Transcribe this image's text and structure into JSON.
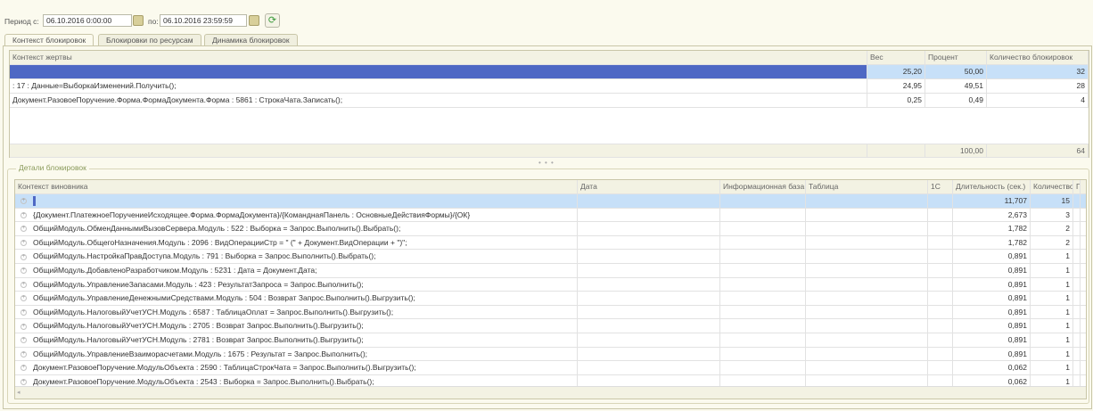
{
  "period": {
    "from_label": "Период с:",
    "from_value": "06.10.2016 0:00:00",
    "to_label": "по:",
    "to_value": "06.10.2016 23:59:59"
  },
  "tabs": [
    {
      "label": "Контекст блокировок",
      "active": true
    },
    {
      "label": "Блокировки по ресурсам"
    },
    {
      "label": "Динамика блокировок"
    }
  ],
  "victims": {
    "columns": [
      "Контекст жертвы",
      "Вес",
      "Процент",
      "Количество блокировок"
    ],
    "rows": [
      {
        "context": "",
        "weight": "25,20",
        "percent": "50,00",
        "count": "32",
        "selected": true
      },
      {
        "context": ": 17 : Данные=ВыборкаИзменений.Получить();",
        "weight": "24,95",
        "percent": "49,51",
        "count": "28"
      },
      {
        "context": "Документ.РазовоеПоручение.Форма.ФормаДокумента.Форма : 5861 : СтрокаЧата.Записать();",
        "weight": "0,25",
        "percent": "0,49",
        "count": "4"
      }
    ],
    "totals": {
      "percent": "100,00",
      "count": "64"
    }
  },
  "details": {
    "group_title": "Детали блокировок",
    "columns": [
      "Контекст виновника",
      "Дата",
      "Информационная база",
      "Таблица",
      "1С",
      "Длительность (сек.)",
      "Количество",
      "П"
    ],
    "rows": [
      {
        "context": "",
        "duration": "11,707",
        "count": "15",
        "selected": true
      },
      {
        "context": "{Документ.ПлатежноеПоручениеИсходящее.Форма.ФормаДокумента}/{КоманднаяПанель : ОсновныеДействияФормы}/{ОК}",
        "duration": "2,673",
        "count": "3"
      },
      {
        "context": "ОбщийМодуль.ОбменДаннымиВызовСервера.Модуль : 522 : Выборка = Запрос.Выполнить().Выбрать();",
        "duration": "1,782",
        "count": "2"
      },
      {
        "context": "ОбщийМодуль.ОбщегоНазначения.Модуль : 2096 : ВидОперацииСтр = \" (\" + Документ.ВидОперации + \")\";",
        "duration": "1,782",
        "count": "2"
      },
      {
        "context": "ОбщийМодуль.НастройкаПравДоступа.Модуль : 791 : Выборка = Запрос.Выполнить().Выбрать();",
        "duration": "0,891",
        "count": "1"
      },
      {
        "context": "ОбщийМодуль.ДобавленоРазработчиком.Модуль : 5231 : Дата = Документ.Дата;",
        "duration": "0,891",
        "count": "1"
      },
      {
        "context": "ОбщийМодуль.УправлениеЗапасами.Модуль : 423 : РезультатЗапроса = Запрос.Выполнить();",
        "duration": "0,891",
        "count": "1"
      },
      {
        "context": "ОбщийМодуль.УправлениеДенежнымиСредствами.Модуль : 504 : Возврат Запрос.Выполнить().Выгрузить();",
        "duration": "0,891",
        "count": "1"
      },
      {
        "context": "ОбщийМодуль.НалоговыйУчетУСН.Модуль : 6587 : ТаблицаОплат = Запрос.Выполнить().Выгрузить();",
        "duration": "0,891",
        "count": "1"
      },
      {
        "context": "ОбщийМодуль.НалоговыйУчетУСН.Модуль : 2705 : Возврат Запрос.Выполнить().Выгрузить();",
        "duration": "0,891",
        "count": "1"
      },
      {
        "context": "ОбщийМодуль.НалоговыйУчетУСН.Модуль : 2781 : Возврат Запрос.Выполнить().Выгрузить();",
        "duration": "0,891",
        "count": "1"
      },
      {
        "context": "ОбщийМодуль.УправлениеВзаиморасчетами.Модуль : 1675 : Результат = Запрос.Выполнить();",
        "duration": "0,891",
        "count": "1"
      },
      {
        "context": "Документ.РазовоеПоручение.МодульОбъекта : 2590 : ТаблицаСтрокЧата = Запрос.Выполнить().Выгрузить();",
        "duration": "0,062",
        "count": "1"
      },
      {
        "context": "Документ.РазовоеПоручение.МодульОбъекта : 2543 : Выборка = Запрос.Выполнить().Выбрать();",
        "duration": "0,062",
        "count": "1"
      }
    ]
  },
  "colors": {
    "selected_blue": "#4e68c4",
    "selected_light": "#c7e0f8",
    "background": "#fbfaee"
  }
}
